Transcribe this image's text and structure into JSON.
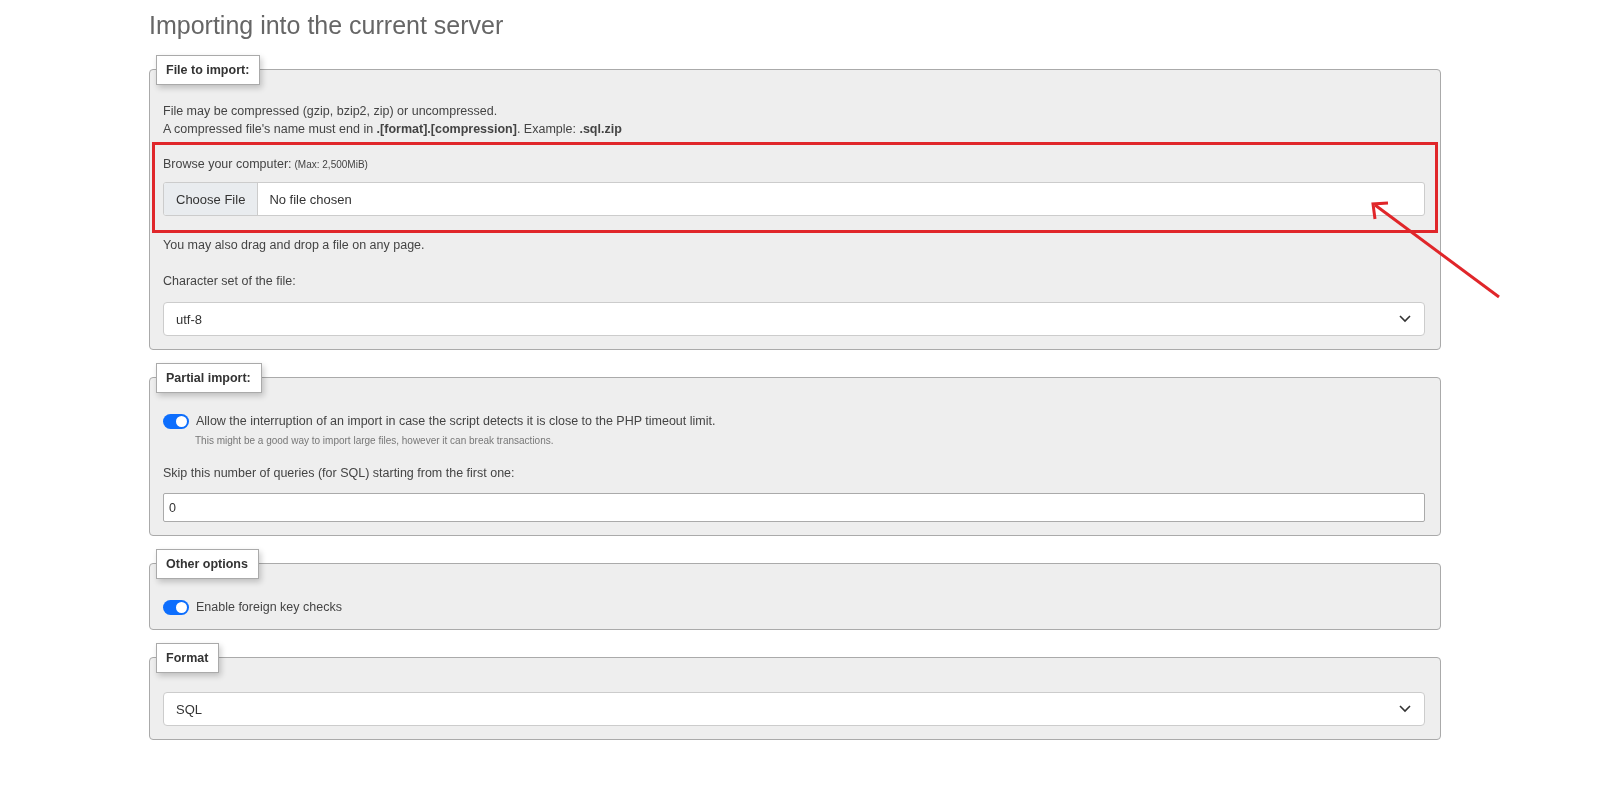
{
  "title": "Importing into the current server",
  "sections": [
    {
      "kind": "file",
      "legend": "File to import:",
      "intro": [
        "File may be compressed (gzip, bzip2, zip) or uncompressed.",
        "A compressed file's name must end in **.[format].[compression]**. Example: **.sql.zip**"
      ],
      "browse_label": "Browse your computer:",
      "browse_max": "(Max: 2,500MiB)",
      "choose_button": "Choose File",
      "file_status": "No file chosen",
      "highlighted": true,
      "drag_note": "You may also drag and drop a file on any page.",
      "charset_label": "Character set of the file:",
      "charset_value": "utf-8"
    },
    {
      "kind": "partial",
      "legend": "Partial import:",
      "toggle": {
        "label": "Allow the interruption of an import in case the script detects it is close to the PHP timeout limit.",
        "on": true,
        "hint": "This might be a good way to import large files, however it can break transactions."
      },
      "skip_label": "Skip this number of queries (for SQL) starting from the first one:",
      "skip_value": "0"
    },
    {
      "kind": "options",
      "legend": "Other options",
      "toggle": {
        "label": "Enable foreign key checks",
        "on": true
      }
    },
    {
      "kind": "format",
      "legend": "Format",
      "format_value": "SQL"
    }
  ]
}
